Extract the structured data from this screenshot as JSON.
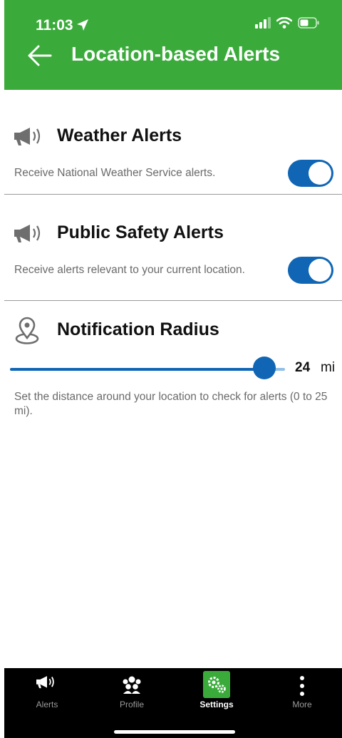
{
  "status_bar": {
    "time": "11:03"
  },
  "header": {
    "title": "Location-based Alerts"
  },
  "weather": {
    "title": "Weather Alerts",
    "description": "Receive National Weather Service alerts.",
    "enabled": true
  },
  "safety": {
    "title": "Public Safety Alerts",
    "description": "Receive alerts relevant to your current location.",
    "enabled": true
  },
  "radius": {
    "title": "Notification Radius",
    "value": "24",
    "unit": "mi",
    "min": 0,
    "max": 25,
    "description": "Set the distance around your location to check for alerts (0 to 25 mi)."
  },
  "tabs": [
    {
      "label": "Alerts",
      "icon": "megaphone-icon",
      "active": false
    },
    {
      "label": "Profile",
      "icon": "people-icon",
      "active": false
    },
    {
      "label": "Settings",
      "icon": "gears-icon",
      "active": true
    },
    {
      "label": "More",
      "icon": "more-vertical-icon",
      "active": false
    }
  ],
  "colors": {
    "brand_green": "#3aab3a",
    "accent_blue": "#1066b4"
  }
}
